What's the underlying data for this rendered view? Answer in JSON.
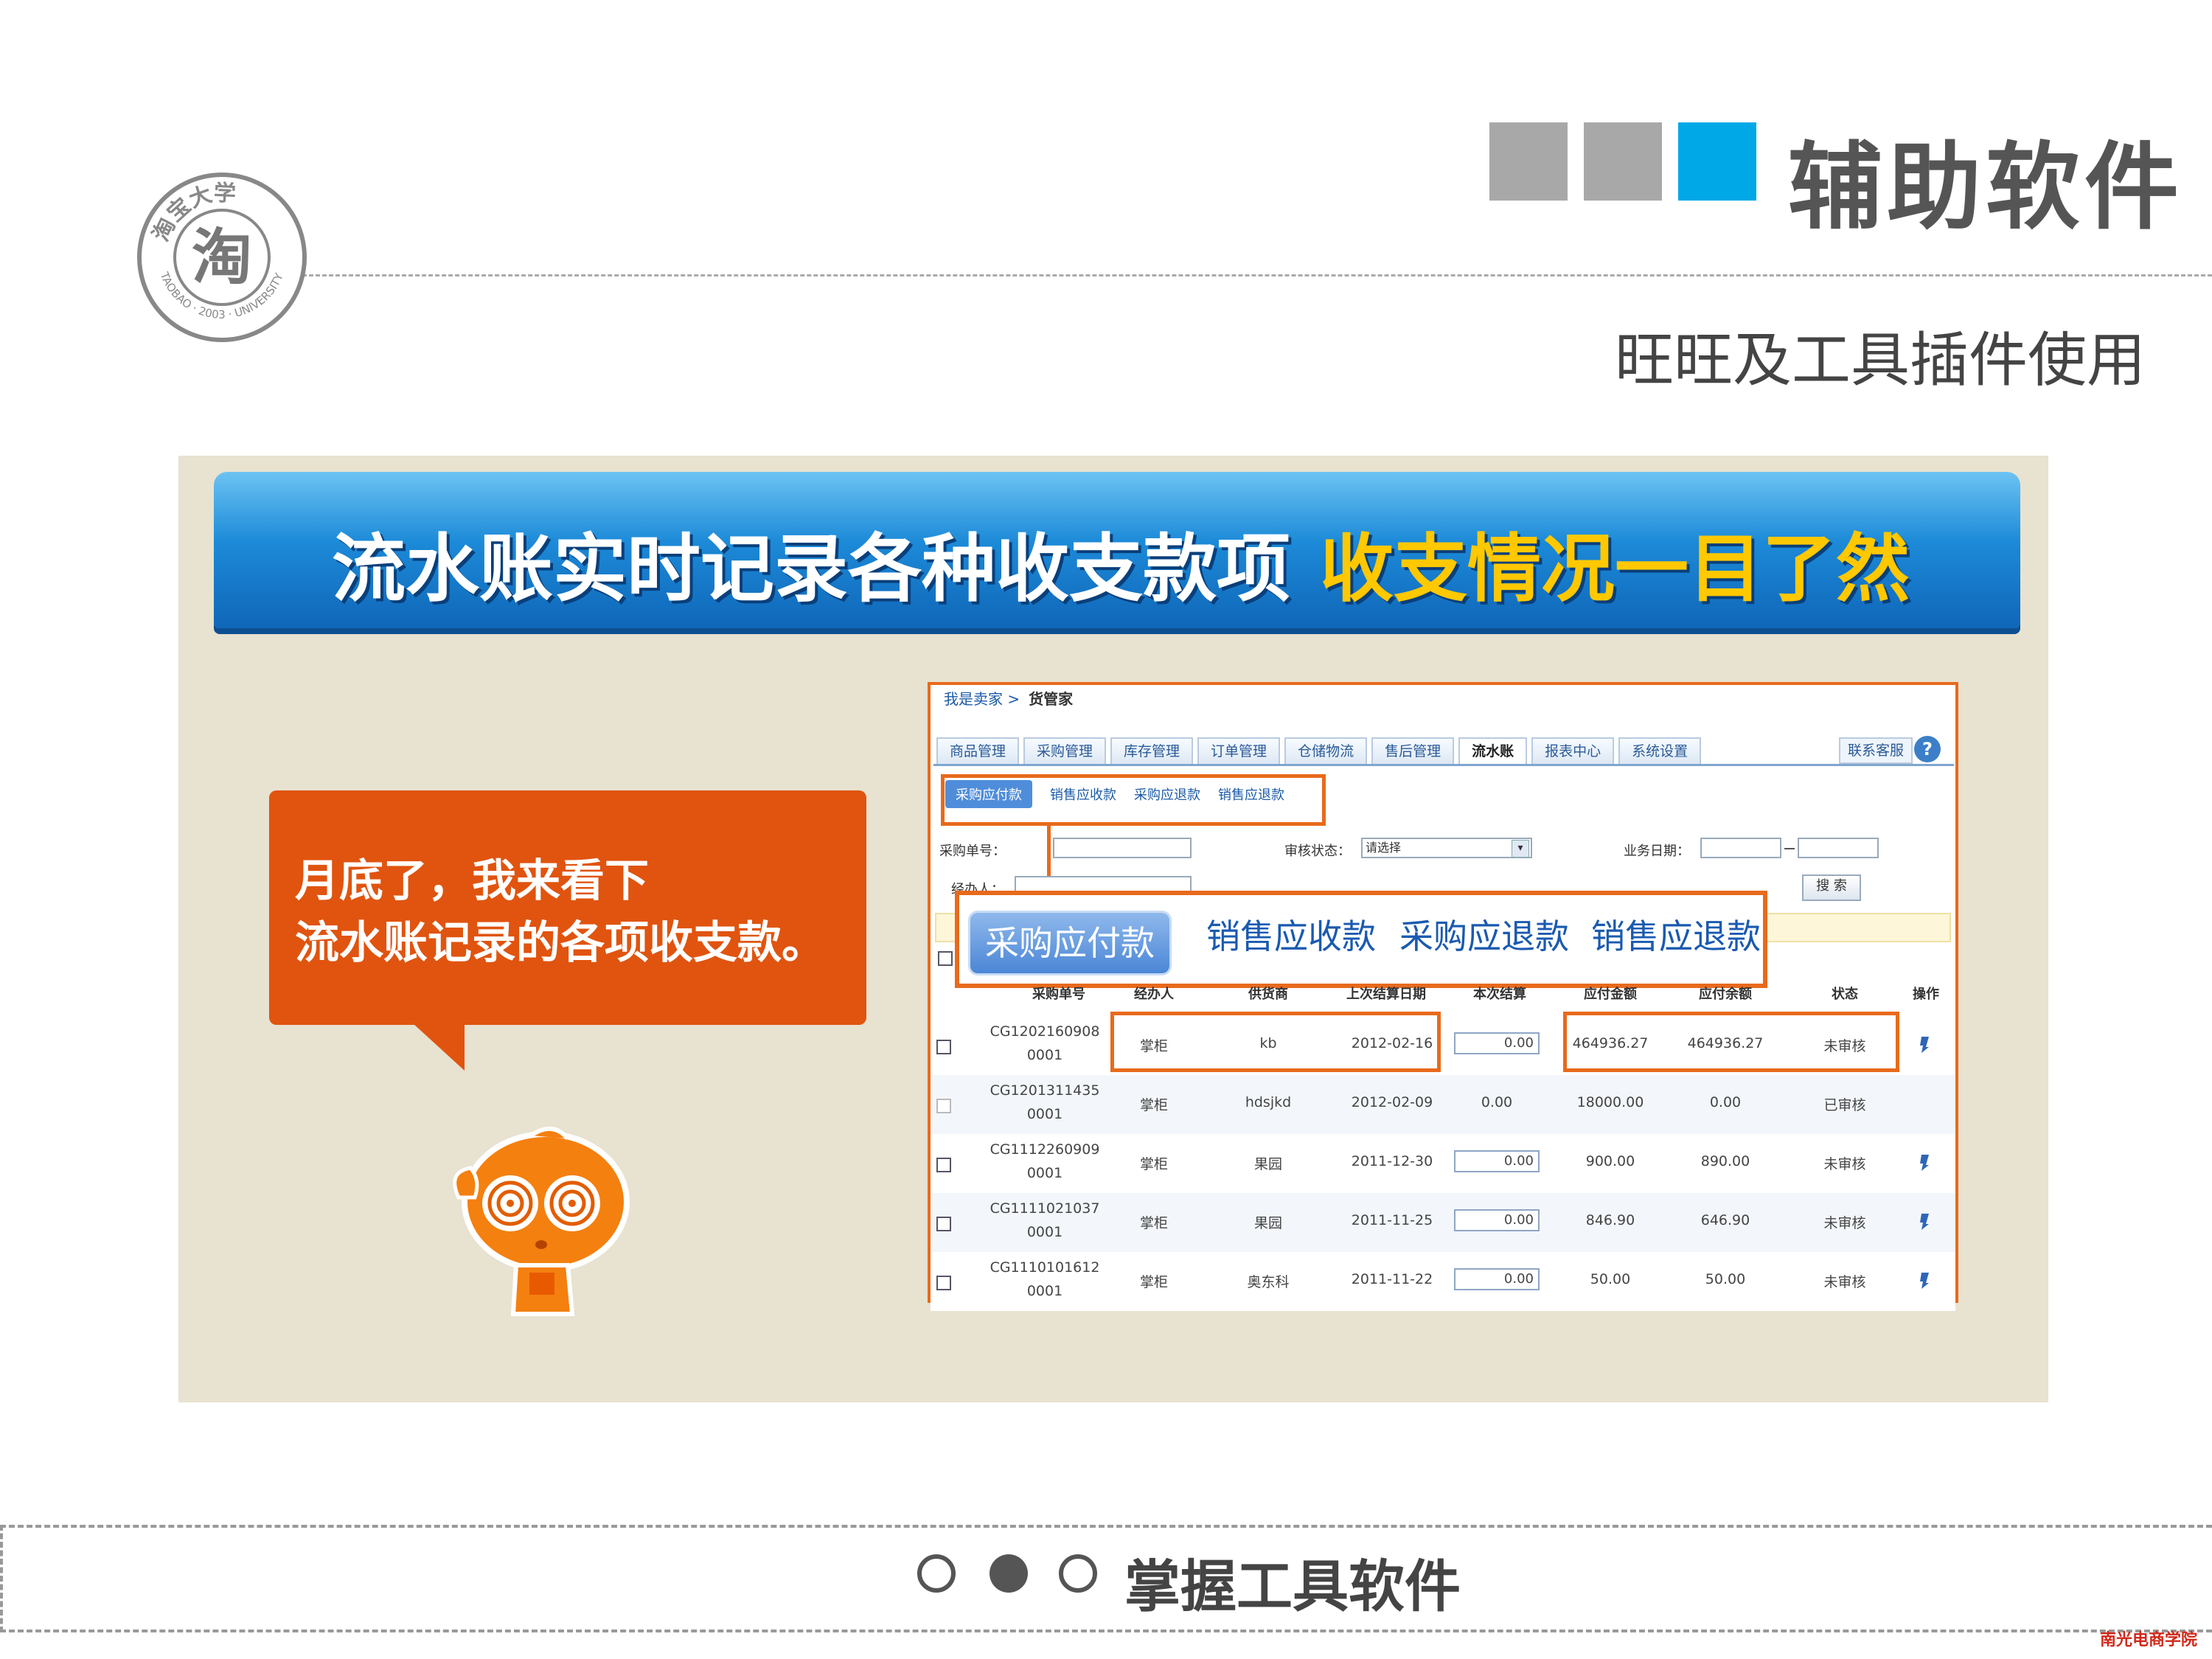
{
  "header": {
    "title": "辅助软件",
    "subtitle": "旺旺及工具插件使用",
    "square_colors": [
      "#a8a8a8",
      "#a8a8a8",
      "#00a8e8"
    ]
  },
  "logo": {
    "text_top": "淘宝大学",
    "center_char": "淘",
    "text_bottom": "TAOBAO · 2003 · UNIVERSITY"
  },
  "banner": {
    "text_white": "流水账实时记录各种收支款项",
    "text_yellow": "收支情况一目了然"
  },
  "bubble": {
    "line1": "月底了，我来看下",
    "line2": "流水账记录的各项收支款。"
  },
  "app": {
    "breadcrumb_link": "我是卖家 >",
    "breadcrumb_current": "货管家",
    "tabs": [
      "商品管理",
      "采购管理",
      "库存管理",
      "订单管理",
      "仓储物流",
      "售后管理",
      "流水账",
      "报表中心",
      "系统设置"
    ],
    "active_tab": "流水账",
    "contact": "联系客服",
    "help_icon": "?",
    "subtabs": [
      "采购应付款",
      "销售应收款",
      "采购应退款",
      "销售应退款"
    ],
    "filters": {
      "order_no_label": "采购单号：",
      "handler_label": "经办人：",
      "review_label": "审核状态：",
      "review_value": "请选择",
      "date_label": "业务日期：",
      "search_button": "搜 索"
    },
    "table": {
      "headers": [
        "采购单号",
        "经办人",
        "供货商",
        "上次结算日期",
        "本次结算",
        "应付金额",
        "应付余额",
        "状态",
        "操作"
      ],
      "rows": [
        {
          "no1": "CG1202160908",
          "no2": "0001",
          "handler": "掌柜",
          "supplier": "kb",
          "date": "2012-02-16",
          "settle": "0.00",
          "payable": "464936.27",
          "balance": "464936.27",
          "status": "未审核",
          "editable": true
        },
        {
          "no1": "CG1201311435",
          "no2": "0001",
          "handler": "掌柜",
          "supplier": "hdsjkd",
          "date": "2012-02-09",
          "settle": "0.00",
          "payable": "18000.00",
          "balance": "0.00",
          "status": "已审核",
          "editable": false
        },
        {
          "no1": "CG1112260909",
          "no2": "0001",
          "handler": "掌柜",
          "supplier": "果园",
          "date": "2011-12-30",
          "settle": "0.00",
          "payable": "900.00",
          "balance": "890.00",
          "status": "未审核",
          "editable": true
        },
        {
          "no1": "CG1111021037",
          "no2": "0001",
          "handler": "掌柜",
          "supplier": "果园",
          "date": "2011-11-25",
          "settle": "0.00",
          "payable": "846.90",
          "balance": "646.90",
          "status": "未审核",
          "editable": true
        },
        {
          "no1": "CG1110101612",
          "no2": "0001",
          "handler": "掌柜",
          "supplier": "奥东科",
          "date": "2011-11-22",
          "settle": "0.00",
          "payable": "50.00",
          "balance": "50.00",
          "status": "未审核",
          "editable": true
        }
      ]
    }
  },
  "footer": {
    "text": "掌握工具软件",
    "stamp": "南光电商学院"
  },
  "colors": {
    "accent_orange": "#e86a1c",
    "bubble_orange": "#e0540f",
    "banner_blue": "#1c8ad8",
    "banner_yellow": "#ffc800"
  }
}
